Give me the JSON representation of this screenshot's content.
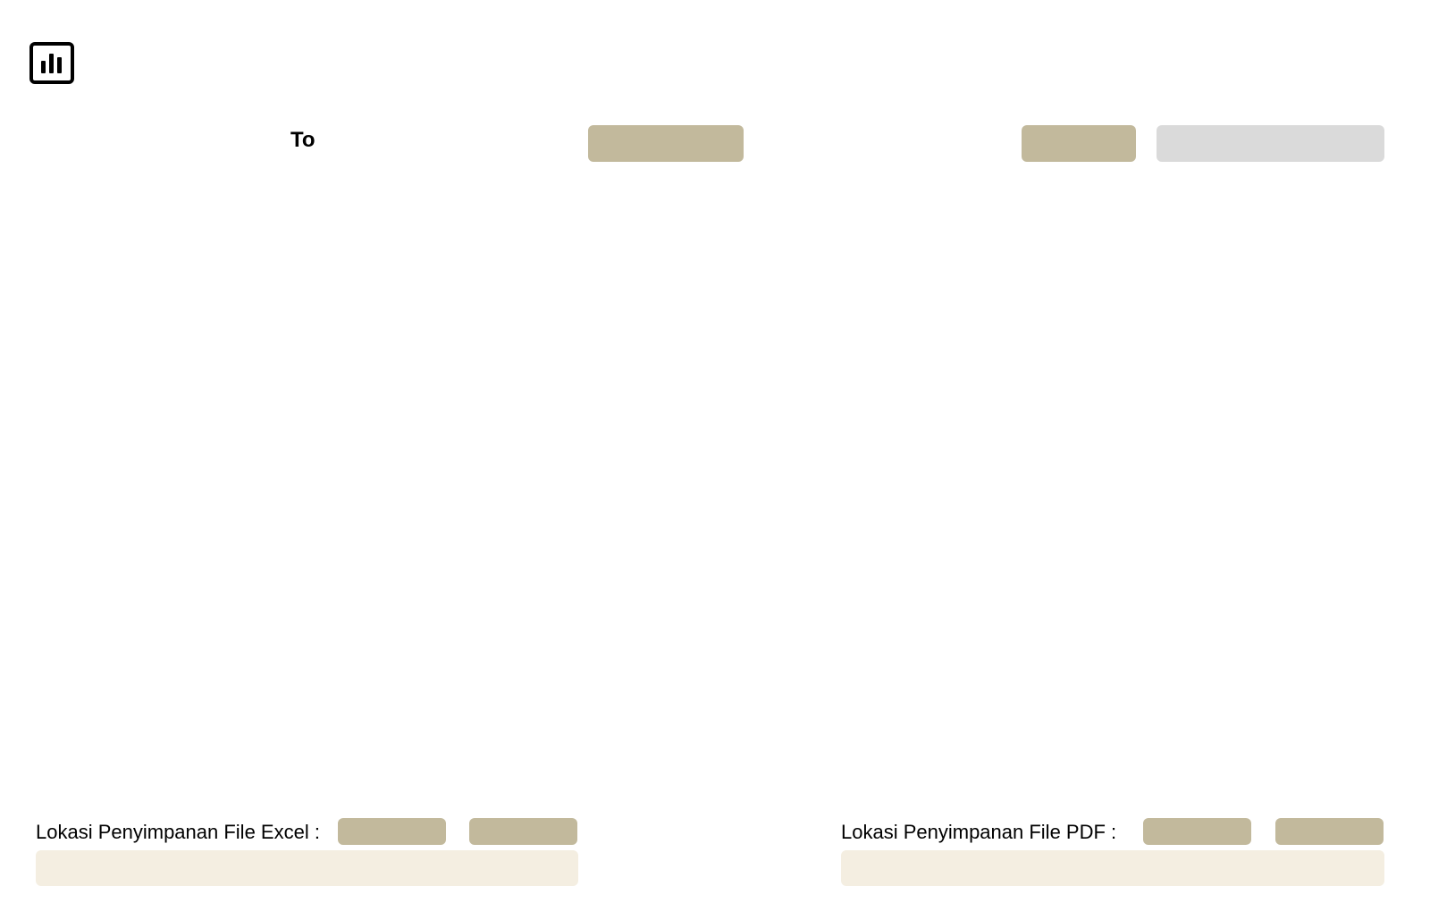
{
  "header": {
    "logo_icon": "bar-chart-icon"
  },
  "filter": {
    "to_label": "To",
    "to_button_label": "",
    "action_button_label": "",
    "select_value": ""
  },
  "export": {
    "excel": {
      "label": "Lokasi Penyimpanan File Excel :",
      "button1_label": "",
      "button2_label": "",
      "path_value": ""
    },
    "pdf": {
      "label": "Lokasi Penyimpanan File PDF :",
      "button1_label": "",
      "button2_label": "",
      "path_value": ""
    }
  },
  "colors": {
    "button_tan": "#c2b99c",
    "field_cream": "#f4eee1",
    "field_grey": "#dadada"
  }
}
